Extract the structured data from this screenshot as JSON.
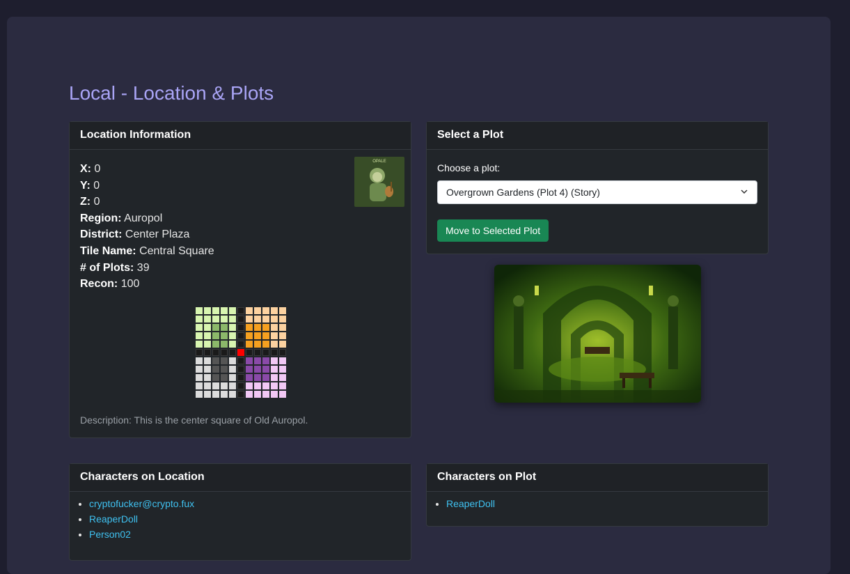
{
  "page": {
    "title": "Local - Location & Plots"
  },
  "location": {
    "header": "Location Information",
    "fields": [
      {
        "label": "X:",
        "value": "0"
      },
      {
        "label": "Y:",
        "value": "0"
      },
      {
        "label": "Z:",
        "value": "0"
      },
      {
        "label": "Region:",
        "value": "Auropol"
      },
      {
        "label": "District:",
        "value": "Center Plaza"
      },
      {
        "label": "Tile Name:",
        "value": "Central Square"
      },
      {
        "label": "# of Plots:",
        "value": "39"
      },
      {
        "label": "Recon:",
        "value": "100"
      }
    ],
    "thumbnail_text": "OPALE",
    "description": "Description: This is the center square of Old Auropol."
  },
  "plot": {
    "header": "Select a Plot",
    "choose_label": "Choose a plot:",
    "selected": "Overgrown Gardens (Plot 4) (Story)",
    "button": "Move to Selected Plot"
  },
  "characters_location": {
    "header": "Characters on Location",
    "items": [
      "cryptofucker@crypto.fux",
      "ReaperDoll",
      "Person02"
    ]
  },
  "characters_plot": {
    "header": "Characters on Plot",
    "items": [
      "ReaperDoll"
    ]
  },
  "colors": {
    "accent": "#a9a4f5",
    "button": "#198754",
    "link": "#3fc1f0",
    "current_tile": "#ff0000"
  }
}
